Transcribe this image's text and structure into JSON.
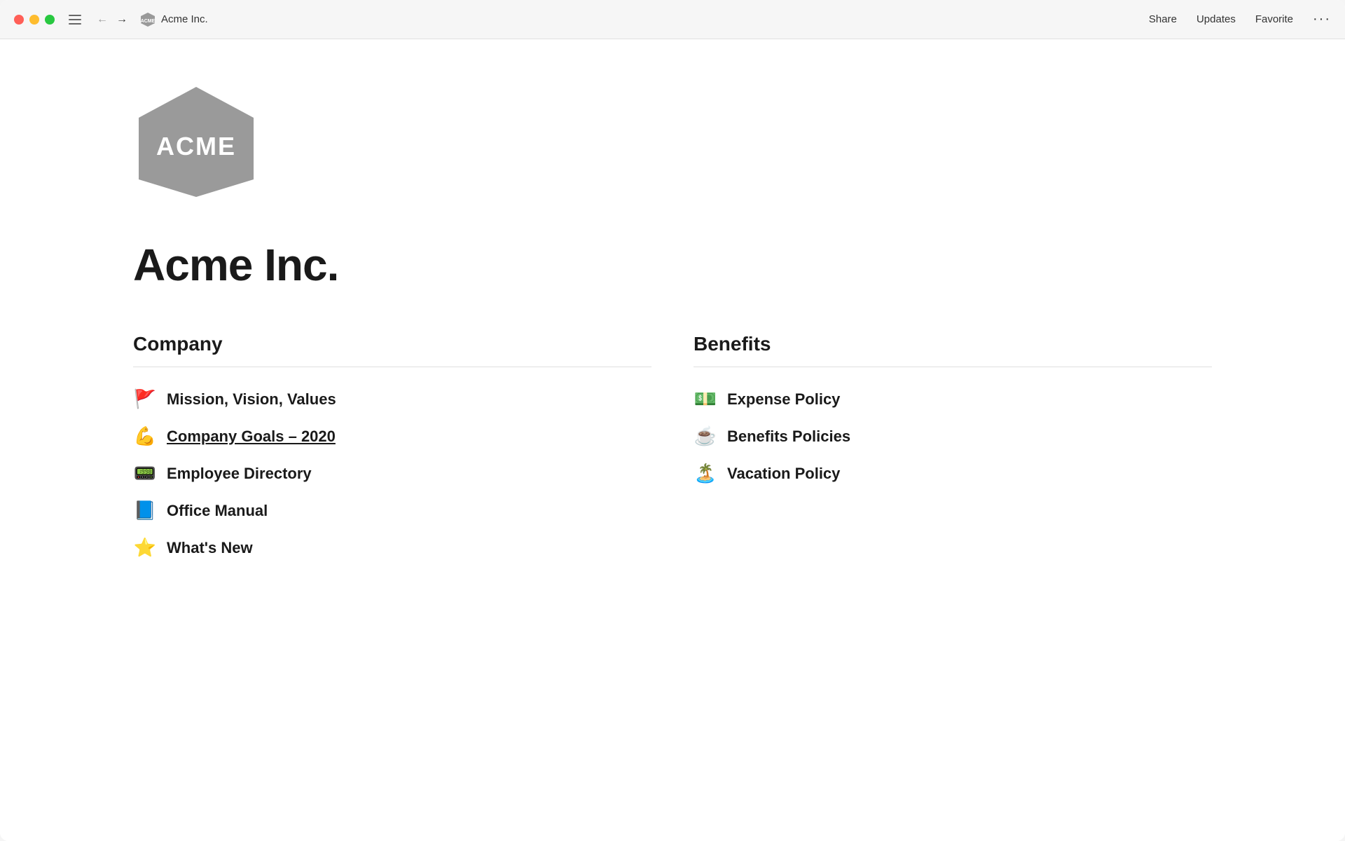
{
  "titlebar": {
    "title": "Acme Inc.",
    "share_label": "Share",
    "updates_label": "Updates",
    "favorite_label": "Favorite",
    "more_label": "···"
  },
  "page": {
    "heading": "Acme Inc.",
    "sections": [
      {
        "id": "company",
        "title": "Company",
        "items": [
          {
            "emoji": "🚩",
            "label": "Mission, Vision, Values",
            "underlined": false
          },
          {
            "emoji": "💪",
            "label": "Company Goals – 2020",
            "underlined": true
          },
          {
            "emoji": "📟",
            "label": "Employee Directory",
            "underlined": false
          },
          {
            "emoji": "📘",
            "label": "Office Manual",
            "underlined": false
          },
          {
            "emoji": "⭐",
            "label": "What's New",
            "underlined": false
          }
        ]
      },
      {
        "id": "benefits",
        "title": "Benefits",
        "items": [
          {
            "emoji": "💵",
            "label": "Expense Policy",
            "underlined": false
          },
          {
            "emoji": "☕",
            "label": "Benefits Policies",
            "underlined": false
          },
          {
            "emoji": "🏝️",
            "label": "Vacation Policy",
            "underlined": false
          }
        ]
      }
    ]
  }
}
